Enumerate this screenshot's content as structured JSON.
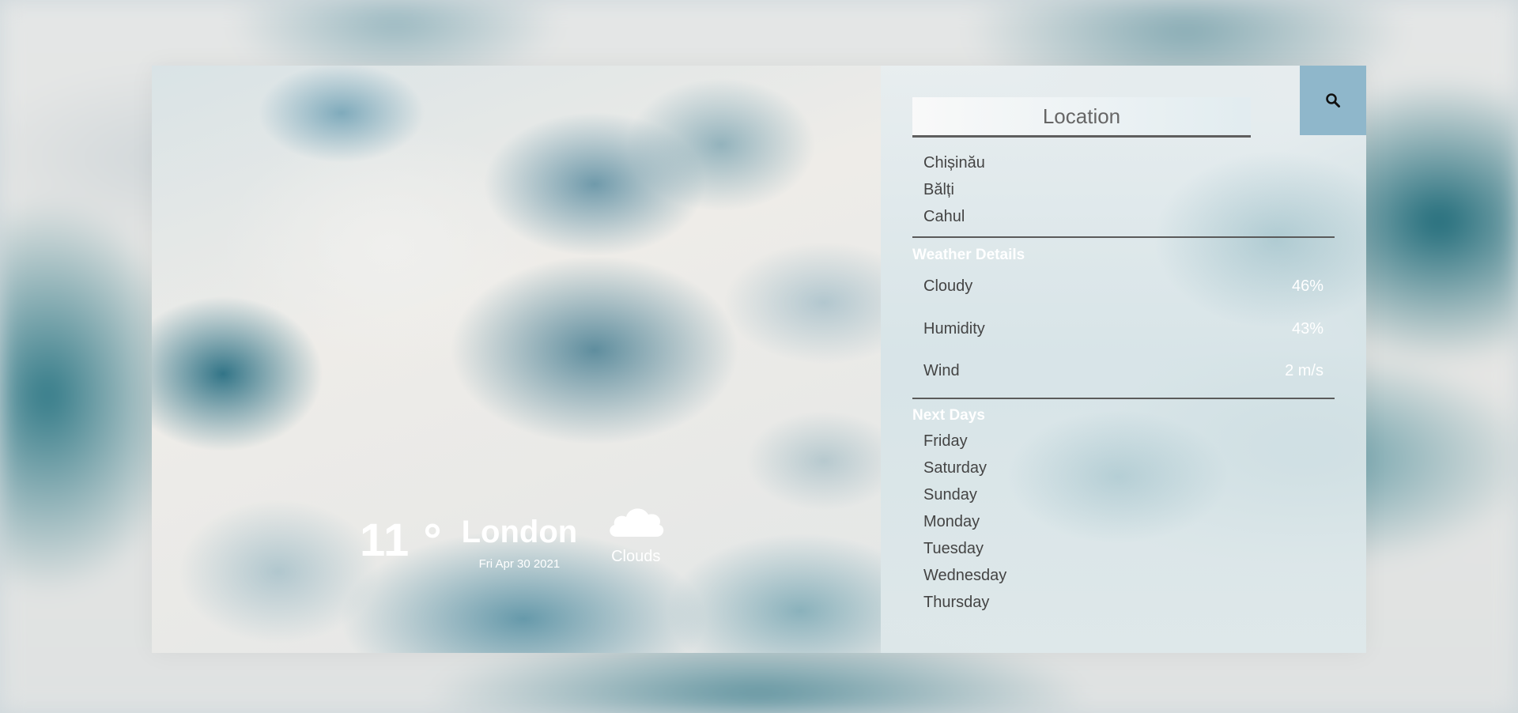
{
  "weather": {
    "temperature": "11 °",
    "city": "London",
    "date": "Fri Apr 30 2021",
    "condition": "Clouds",
    "condition_icon": "cloud-icon"
  },
  "search": {
    "placeholder": "Location",
    "icon": "search-icon"
  },
  "locations": [
    "Chișinău",
    "Bălți",
    "Cahul"
  ],
  "details": {
    "title": "Weather Details",
    "rows": [
      {
        "label": "Cloudy",
        "value": "46%"
      },
      {
        "label": "Humidity",
        "value": "43%"
      },
      {
        "label": "Wind",
        "value": "2 m/s"
      }
    ]
  },
  "next_days": {
    "title": "Next Days",
    "days": [
      "Friday",
      "Saturday",
      "Sunday",
      "Monday",
      "Tuesday",
      "Wednesday",
      "Thursday"
    ]
  },
  "colors": {
    "search_button": "#8fb7cb",
    "text_dark": "#444444",
    "text_light": "#ffffff"
  }
}
